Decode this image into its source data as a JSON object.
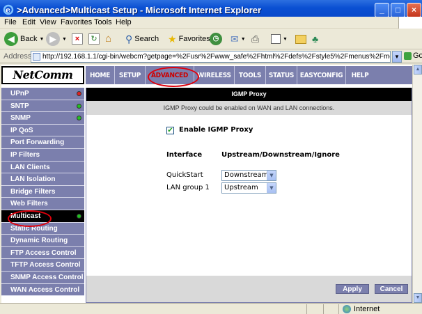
{
  "window": {
    "title": ">Advanced>Multicast Setup - Microsoft Internet Explorer"
  },
  "menu": [
    "File",
    "Edit",
    "View",
    "Favorites",
    "Tools",
    "Help"
  ],
  "toolbar": {
    "back": "Back",
    "search": "Search",
    "favorites": "Favorites"
  },
  "address": {
    "label": "Address",
    "url": "http://192.168.1.1/cgi-bin/webcm?getpage=%2Fusr%2Fwww_safe%2Fhtml%2Fdefs%2Fstyle5%2Fmenus%2Fmenu.html&var:style",
    "go": "Go"
  },
  "router": {
    "logo": "NetComm",
    "topnav": [
      "HOME",
      "SETUP",
      "ADVANCED",
      "WIRELESS",
      "TOOLS",
      "STATUS",
      "EASYCONFIG",
      "HELP"
    ],
    "active_top": "ADVANCED",
    "sidenav": [
      {
        "label": "UPnP",
        "status": "red"
      },
      {
        "label": "SNTP",
        "status": "green"
      },
      {
        "label": "SNMP",
        "status": "green"
      },
      {
        "label": "IP QoS"
      },
      {
        "label": "Port Forwarding"
      },
      {
        "label": "IP Filters"
      },
      {
        "label": "LAN Clients"
      },
      {
        "label": "LAN Isolation"
      },
      {
        "label": "Bridge Filters"
      },
      {
        "label": "Web Filters"
      },
      {
        "label": "Multicast",
        "active": true,
        "status": "green"
      },
      {
        "label": "Static Routing"
      },
      {
        "label": "Dynamic Routing"
      },
      {
        "label": "FTP Access Control"
      },
      {
        "label": "TFTP Access Control"
      },
      {
        "label": "SNMP Access Control"
      },
      {
        "label": "WAN Access Control"
      }
    ],
    "panel": {
      "title": "IGMP Proxy",
      "description": "IGMP Proxy could be enabled on WAN and LAN connections.",
      "enable_label": "Enable IGMP Proxy",
      "enable_checked": true,
      "col_interface": "Interface",
      "col_mode": "Upstream/Downstream/Ignore",
      "rows": [
        {
          "interface": "QuickStart",
          "mode": "Downstream"
        },
        {
          "interface": "LAN group 1",
          "mode": "Upstream"
        }
      ],
      "apply": "Apply",
      "cancel": "Cancel"
    }
  },
  "status": {
    "zone": "Internet"
  },
  "colors": {
    "nav": "#7b7fad",
    "active_red": "#cc0000",
    "xp_blue": "#0a4fd2"
  }
}
